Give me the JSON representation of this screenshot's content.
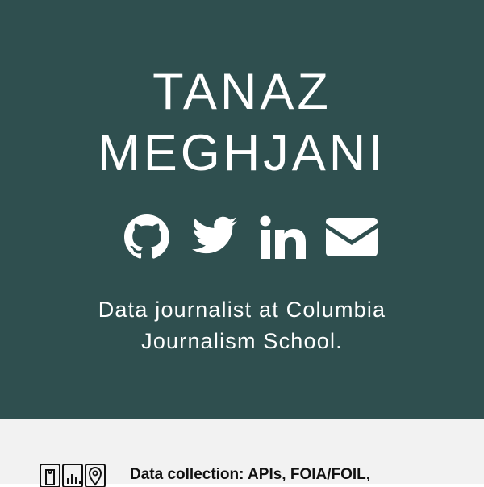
{
  "profile": {
    "name_line1": "TANAZ",
    "name_line2": "MEGHJANI",
    "tagline_line1": "Data journalist at Columbia",
    "tagline_line2": "Journalism School."
  },
  "social": [
    {
      "icon": "github-icon"
    },
    {
      "icon": "twitter-icon"
    },
    {
      "icon": "linkedin-icon"
    },
    {
      "icon": "email-icon"
    }
  ],
  "skills": {
    "first_item": "Data collection: APIs, FOIA/FOIL,"
  },
  "colors": {
    "hero_background": "#2f4f4f",
    "lower_background": "#f2f2f2",
    "text_light": "#ffffff",
    "text_dark": "#111111"
  }
}
